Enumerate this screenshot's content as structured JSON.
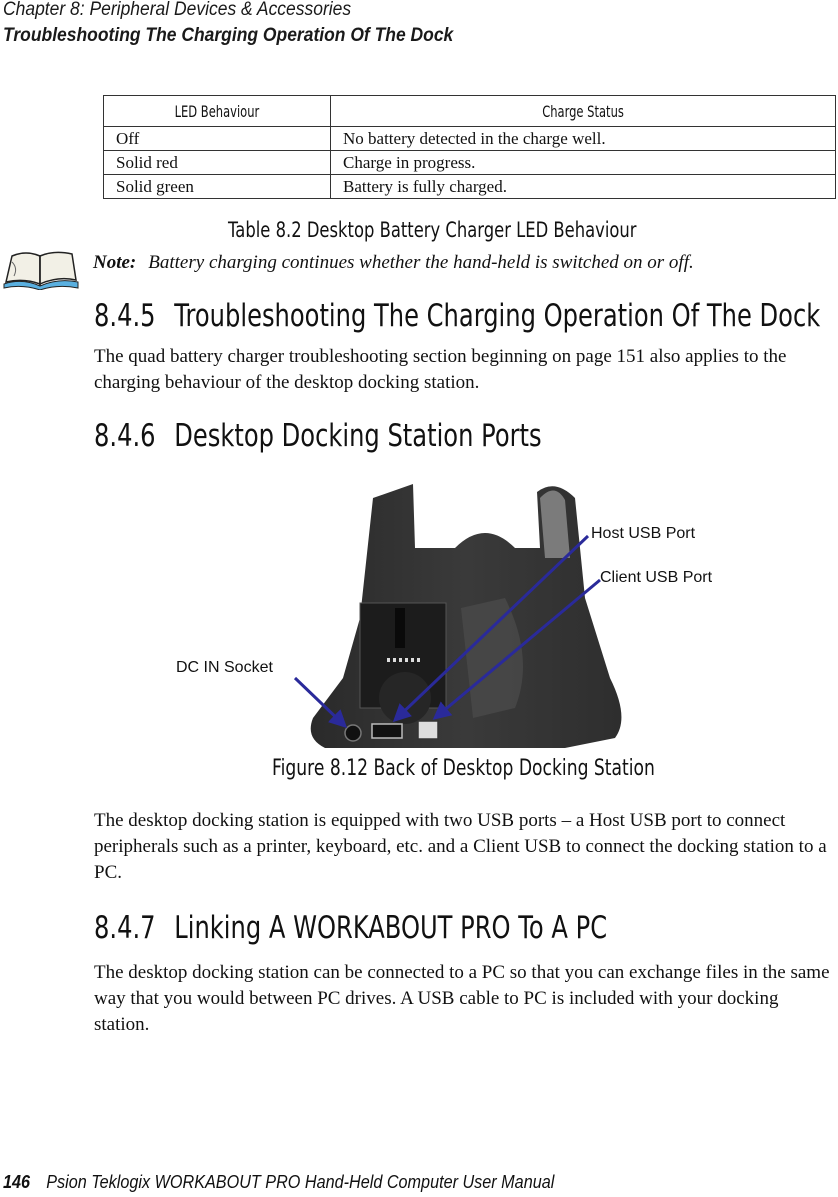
{
  "header": {
    "chapter": "Chapter  8:  Peripheral Devices & Accessories",
    "section": "Troubleshooting The Charging Operation Of The Dock"
  },
  "table": {
    "headers": [
      "LED Behaviour",
      "Charge Status"
    ],
    "rows": [
      [
        "Off",
        "No battery detected in the charge well."
      ],
      [
        "Solid red",
        "Charge in progress."
      ],
      [
        "Solid green",
        "Battery is fully charged."
      ]
    ],
    "caption": "Table 8.2  Desktop Battery Charger LED Behaviour"
  },
  "note": {
    "icon": "open-book-icon",
    "label": "Note:",
    "text": "Battery charging continues whether the hand-held is switched on or off."
  },
  "sections": [
    {
      "number": "8.4.5",
      "title": "Troubleshooting The Charging Operation Of The Dock",
      "paragraphs": [
        "The quad battery charger troubleshooting section beginning on page 151 also applies to the charging behaviour of the desktop docking station."
      ]
    },
    {
      "number": "8.4.6",
      "title": "Desktop Docking Station Ports",
      "paragraphs": [
        "The desktop docking station is equipped with two USB ports – a Host USB port to connect peripherals such as a printer, keyboard, etc. and a Client USB to connect the docking station to a PC."
      ]
    },
    {
      "number": "8.4.7",
      "title": "Linking A WORKABOUT  PRO  To  A  PC",
      "paragraphs": [
        "The desktop docking station can be connected to a PC so that you can exchange files in the same way that you would between PC drives. A USB cable to PC is included with your docking station."
      ]
    }
  ],
  "figure": {
    "caption": "Figure 8.12 Back of Desktop Docking Station",
    "callouts": [
      "Host USB Port",
      "Client USB Port",
      "DC IN Socket"
    ],
    "arrow_color": "#2a2a9a"
  },
  "footer": {
    "page_number": "146",
    "title": "Psion Teklogix WORKABOUT PRO Hand-Held Computer User Manual"
  }
}
